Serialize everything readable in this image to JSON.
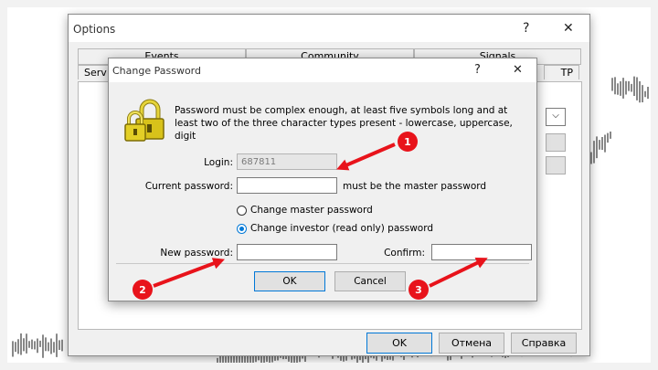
{
  "options_dialog": {
    "title": "Options",
    "help_glyph": "?",
    "close_glyph": "✕",
    "tabs_top": [
      "Events",
      "Community",
      "Signals"
    ],
    "tabs_second": [
      "Serv",
      "TP"
    ],
    "combo_glyph": "⌵",
    "ok_label": "OK",
    "cancel_label": "Отмена",
    "help_label": "Справка"
  },
  "change_password": {
    "title": "Change Password",
    "help_glyph": "?",
    "close_glyph": "✕",
    "message": "Password must be complex enough, at least five symbols long and at least two of the three character types present - lowercase, uppercase, digit",
    "login_label": "Login:",
    "login_value": "687811",
    "current_password_label": "Current password:",
    "current_password_value": "",
    "current_password_hint": "must be the master password",
    "radio_master": "Change master password",
    "radio_investor": "Change investor (read only) password",
    "selected_option": "investor",
    "new_password_label": "New password:",
    "new_password_value": "",
    "confirm_label": "Confirm:",
    "confirm_value": "",
    "ok_label": "OK",
    "cancel_label": "Cancel"
  },
  "annotations": {
    "marker_1": "1",
    "marker_2": "2",
    "marker_3": "3",
    "color": "#e8131b"
  },
  "colors": {
    "accent": "#0078d7",
    "lock_gold": "#d8c21a"
  }
}
